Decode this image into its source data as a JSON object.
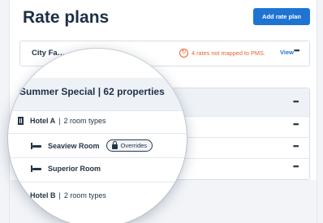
{
  "page": {
    "title": "Rate plans",
    "add_button": "Add rate plan"
  },
  "city_card": {
    "title": "City Fa…",
    "warning_icon": "sync-alert-icon",
    "warning": "4 rates not mapped to PMS.",
    "view": "View",
    "more": "•••"
  },
  "plan_card": {
    "more": "•••"
  },
  "lens": {
    "header": "Summer Special  | 62 properties",
    "hotel_a": {
      "name": "Hotel A",
      "sep": "|",
      "types": "2 room types"
    },
    "seaview": {
      "name": "Seaview Room",
      "badge": "Overrides"
    },
    "superior": {
      "name": "Superior Room"
    },
    "hotel_b": {
      "name": "Hotel B",
      "sep": "|",
      "types": "2 room types"
    }
  },
  "colors": {
    "accent": "#1d74d3",
    "warning": "#e8642c",
    "text": "#1d2f46"
  }
}
